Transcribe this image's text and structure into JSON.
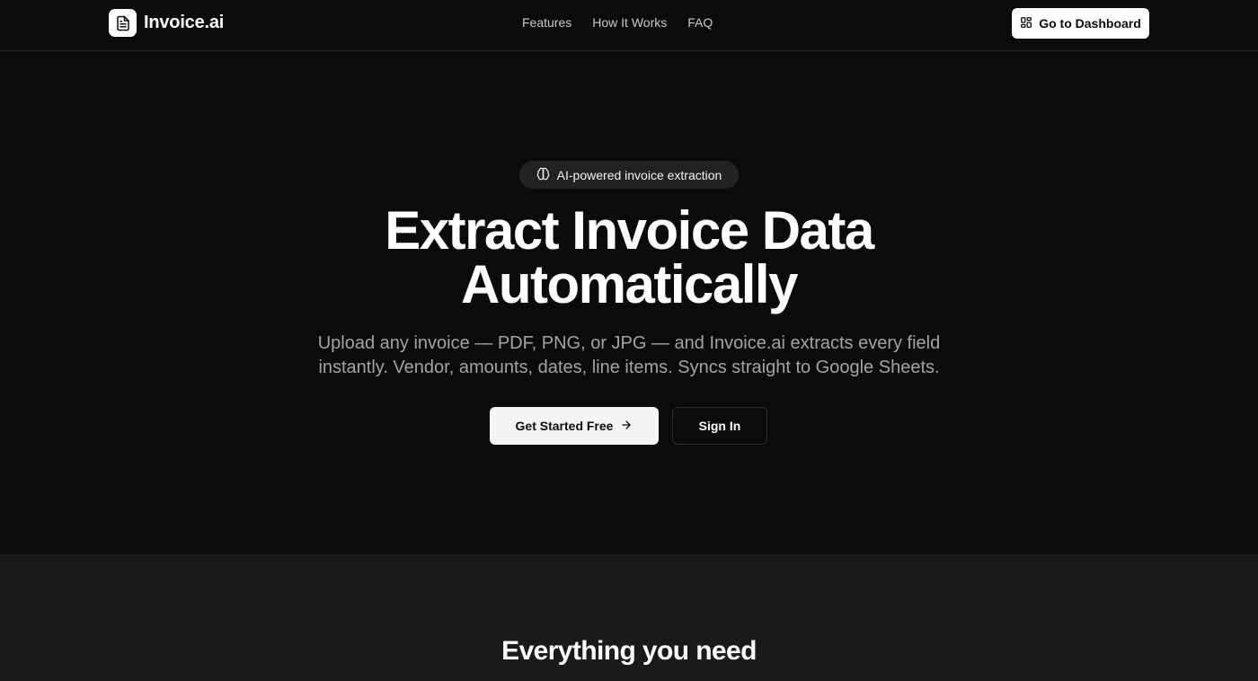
{
  "brand": {
    "name": "Invoice.ai",
    "logo_icon": "document-icon"
  },
  "nav": {
    "links": [
      {
        "label": "Features"
      },
      {
        "label": "How It Works"
      },
      {
        "label": "FAQ"
      }
    ],
    "dashboard_button": {
      "label": "Go to Dashboard",
      "icon": "grid-icon"
    }
  },
  "hero": {
    "badge": {
      "label": "AI-powered invoice extraction",
      "icon": "brain-icon"
    },
    "title_line1": "Extract Invoice Data",
    "title_line2": "Automatically",
    "subtitle_line1": "Upload any invoice — PDF, PNG, or JPG — and Invoice.ai extracts every field",
    "subtitle_line2": "instantly. Vendor, amounts, dates, line items. Syncs straight to Google Sheets.",
    "primary_cta": {
      "label": "Get Started Free",
      "icon": "arrow-right-icon"
    },
    "secondary_cta": {
      "label": "Sign In"
    }
  },
  "features": {
    "title": "Everything you need"
  },
  "colors": {
    "background": "#0b0b0b",
    "section_alt": "#1a1a1a",
    "text_primary": "#ffffff",
    "text_muted": "#a3a3a3",
    "button_light": "#f5f5f5"
  }
}
